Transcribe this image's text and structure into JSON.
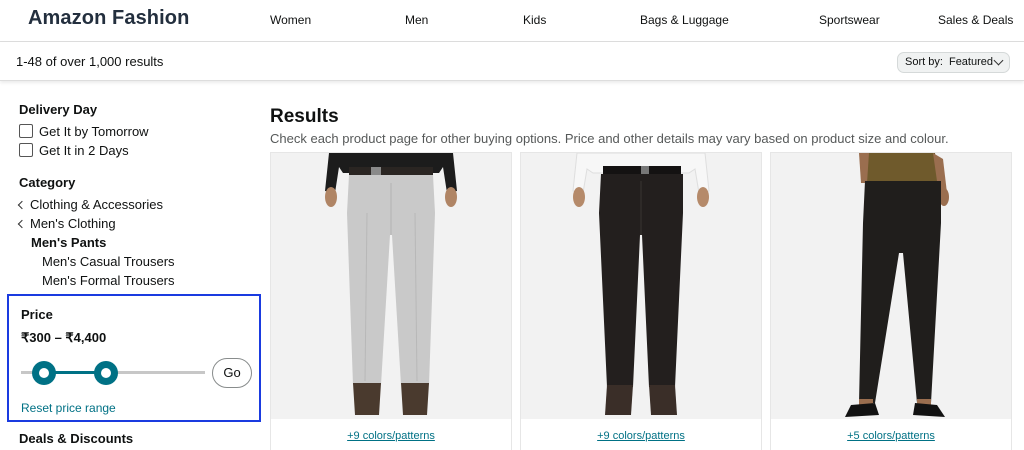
{
  "header": {
    "brand": "Amazon Fashion",
    "nav": [
      "Women",
      "Men",
      "Kids",
      "Bags & Luggage",
      "Sportswear",
      "Sales & Deals"
    ]
  },
  "results_bar": {
    "count": "1-48 of over 1,000 results",
    "sort_label": "Sort by:",
    "sort_value": "Featured"
  },
  "sidebar": {
    "delivery": {
      "heading": "Delivery Day",
      "options": [
        "Get It by Tomorrow",
        "Get It in 2 Days"
      ]
    },
    "category": {
      "heading": "Category",
      "items": [
        "Clothing & Accessories",
        "Men's Clothing",
        "Men's Pants",
        "Men's Casual Trousers",
        "Men's Formal Trousers"
      ]
    },
    "price": {
      "heading": "Price",
      "range": "₹300 – ₹4,400",
      "go_label": "Go",
      "reset_label": "Reset price range"
    },
    "deals": {
      "heading": "Deals & Discounts"
    }
  },
  "main": {
    "title": "Results",
    "subtitle": "Check each product page for other buying options. Price and other details may vary based on product size and colour.",
    "products": [
      {
        "colors_link": "+9 colors/patterns",
        "pant_color": "#c9c9c9",
        "shirt_color": "#1c1c1c"
      },
      {
        "colors_link": "+9 colors/patterns",
        "pant_color": "#231f1e",
        "shirt_color": "#f3f3f3"
      },
      {
        "colors_link": "+5 colors/patterns",
        "pant_color": "#201e1c",
        "shirt_color": "#6f5a2c"
      }
    ]
  },
  "colors": {
    "accent": "#007185",
    "highlight_border": "#1a3be0"
  }
}
